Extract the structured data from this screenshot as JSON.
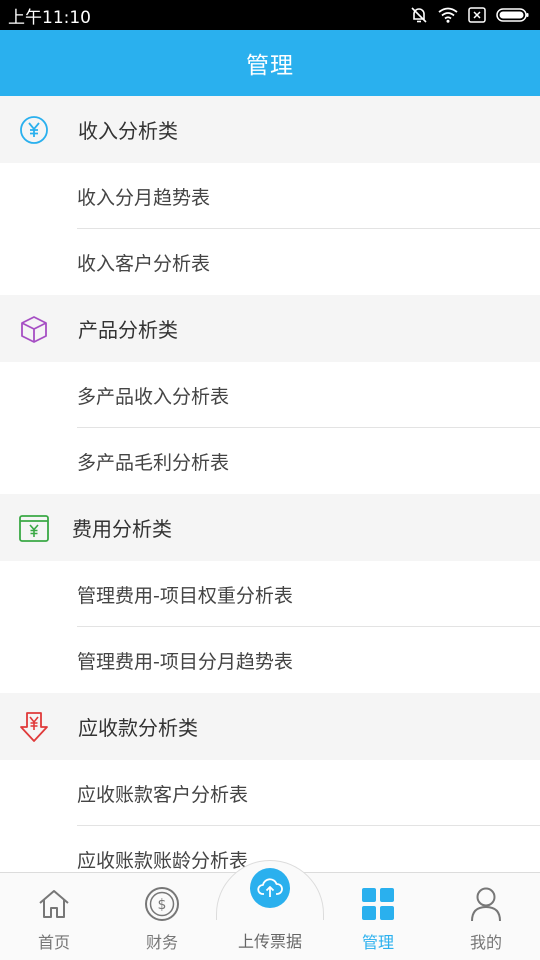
{
  "status_bar": {
    "time": "上午11:10"
  },
  "header": {
    "title": "管理"
  },
  "sections": [
    {
      "title": "收入分析类",
      "icon": "yen-circle-icon",
      "color": "#2ab0ee",
      "items": [
        "收入分月趋势表",
        "收入客户分析表"
      ]
    },
    {
      "title": "产品分析类",
      "icon": "cube-icon",
      "color": "#a64fc4",
      "items": [
        "多产品收入分析表",
        "多产品毛利分析表"
      ]
    },
    {
      "title": "费用分析类",
      "icon": "yen-wallet-icon",
      "color": "#3aa845",
      "items": [
        "管理费用-项目权重分析表",
        "管理费用-项目分月趋势表"
      ]
    },
    {
      "title": "应收款分析类",
      "icon": "yen-arrow-down-icon",
      "color": "#e03a3a",
      "items": [
        "应收账款客户分析表",
        "应收账款账龄分析表"
      ]
    }
  ],
  "tabbar": {
    "tabs": [
      {
        "label": "首页",
        "icon": "home-icon",
        "active": false
      },
      {
        "label": "财务",
        "icon": "coin-icon",
        "active": false
      },
      {
        "label": "上传票据",
        "icon": "cloud-upload-icon",
        "active": false
      },
      {
        "label": "管理",
        "icon": "grid-icon",
        "active": true
      },
      {
        "label": "我的",
        "icon": "person-icon",
        "active": false
      }
    ]
  },
  "colors": {
    "accent": "#2ab0ee",
    "section_bg": "#f5f5f5",
    "divider": "#e3e3e3"
  }
}
